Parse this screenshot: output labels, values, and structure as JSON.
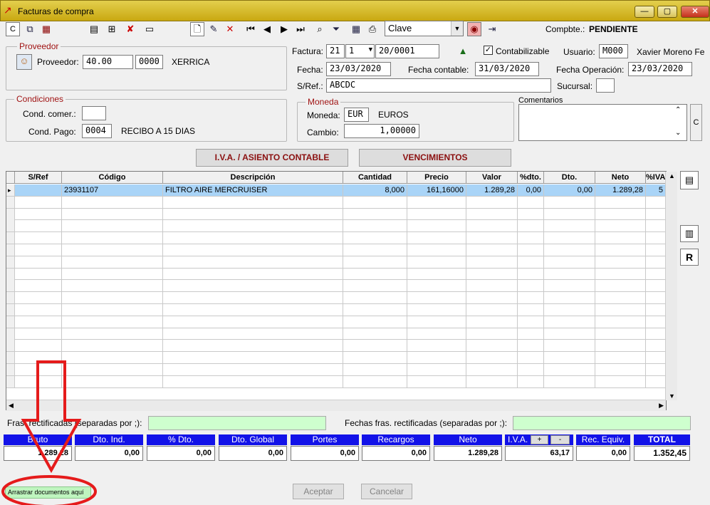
{
  "window": {
    "title": "Facturas de compra",
    "min": "—",
    "max": "▢",
    "close": "✕"
  },
  "toolbar": {
    "c_label": "C",
    "combo_value": "Clave",
    "compbte_label": "Compbte.:",
    "compbte_value": "PENDIENTE"
  },
  "proveedor": {
    "group_label": "Proveedor",
    "label": "Proveedor:",
    "code": "40.00",
    "sub": "0000",
    "name": "XERRICA"
  },
  "condiciones": {
    "group_label": "Condiciones",
    "com_label": "Cond. comer.:",
    "com_value": "",
    "pago_label": "Cond. Pago:",
    "pago_code": "0004",
    "pago_desc": "RECIBO A 15 DIAS"
  },
  "factura": {
    "label": "Factura:",
    "serie": "21",
    "num": "1",
    "code": "20/0001",
    "contabilizable_label": "Contabilizable",
    "contabilizable_checked": true,
    "usuario_label": "Usuario:",
    "usuario_code": "M000",
    "usuario_name": "Xavier Moreno Fe",
    "fecha_label": "Fecha:",
    "fecha": "23/03/2020",
    "fecha_contable_label": "Fecha contable:",
    "fecha_contable": "31/03/2020",
    "fecha_op_label": "Fecha Operación:",
    "fecha_op": "23/03/2020",
    "sref_label": "S/Ref.:",
    "sref": "ABCDC",
    "sucursal_label": "Sucursal:",
    "sucursal": ""
  },
  "moneda": {
    "group_label": "Moneda",
    "label": "Moneda:",
    "code": "EUR",
    "name": "EUROS",
    "cambio_label": "Cambio:",
    "cambio": "1,00000"
  },
  "comentarios": {
    "label": "Comentarios",
    "value": "",
    "side_btn": "C"
  },
  "buttons": {
    "iva": "I.V.A. / ASIENTO CONTABLE",
    "venc": "VENCIMIENTOS",
    "aceptar": "Aceptar",
    "cancelar": "Cancelar",
    "r_btn": "R"
  },
  "grid": {
    "columns": [
      "S/Ref",
      "Código",
      "Descripción",
      "Cantidad",
      "Precio",
      "Valor",
      "%dto.",
      "Dto.",
      "Neto",
      "%IVA"
    ],
    "rows": [
      [
        "",
        "23931107",
        "FILTRO AIRE MERCRUISER",
        "8,000",
        "161,16000",
        "1.289,28",
        "0,00",
        "0,00",
        "1.289,28",
        "5"
      ]
    ]
  },
  "rectificadas": {
    "fras_label": "Fras. rectificadas (separadas por ;):",
    "fras_value": "",
    "fechas_label": "Fechas fras. rectificadas (separadas por ;):",
    "fechas_value": ""
  },
  "totals": [
    {
      "label": "Bruto",
      "value": "1.289,28"
    },
    {
      "label": "Dto. Ind.",
      "value": "0,00"
    },
    {
      "label": "% Dto.",
      "value": "0,00"
    },
    {
      "label": "Dto. Global",
      "value": "0,00"
    },
    {
      "label": "Portes",
      "value": "0,00"
    },
    {
      "label": "Recargos",
      "value": "0,00"
    },
    {
      "label": "Neto",
      "value": "1.289,28"
    },
    {
      "label": "I.V.A.",
      "value": "63,17"
    },
    {
      "label": "Rec. Equiv.",
      "value": "0,00"
    },
    {
      "label": "TOTAL",
      "value": "1.352,45"
    }
  ],
  "iva_plus": "+",
  "iva_minus": "-",
  "drop_zone": "Arrastrar documentos aquí",
  "annotation_color": "#e51b1b"
}
